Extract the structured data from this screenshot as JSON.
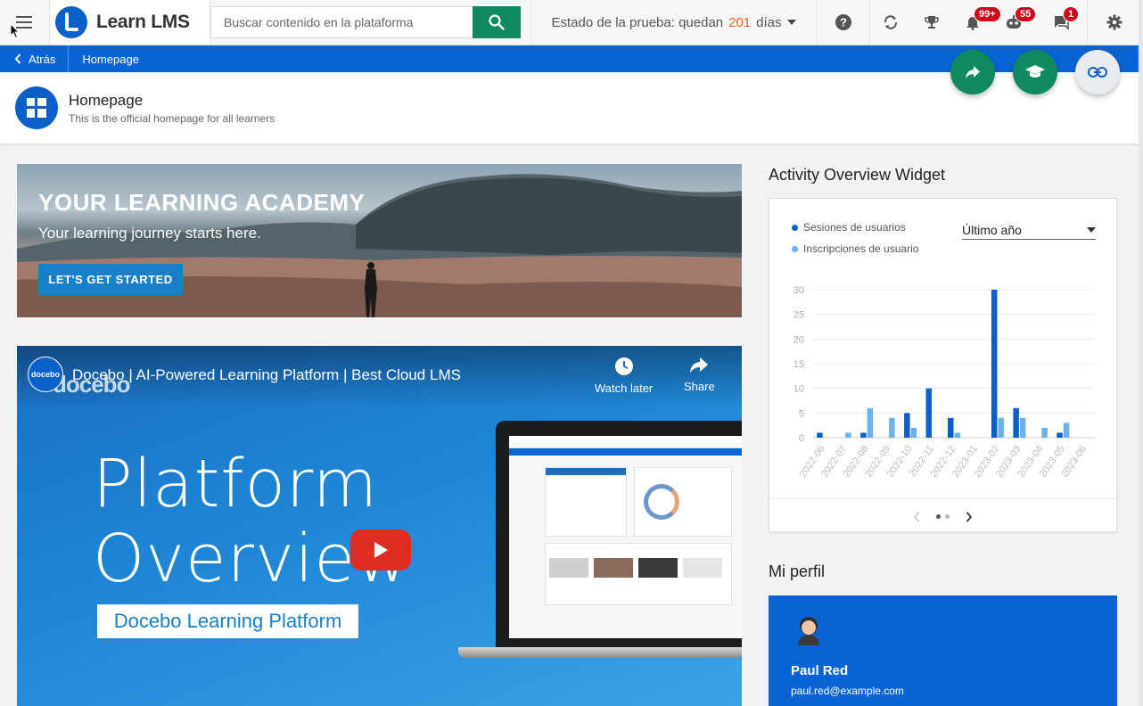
{
  "header": {
    "app_name": "Learn LMS",
    "search_placeholder": "Buscar contenido en la plataforma",
    "trial_prefix": "Estado de la prueba: quedan",
    "trial_days": "201",
    "trial_suffix": "días",
    "notifications_badge": "99+",
    "messages_badge": "55",
    "chat_badge": "1"
  },
  "breadcrumb": {
    "back_label": "Atrás",
    "current": "Homepage"
  },
  "page": {
    "title": "Homepage",
    "subtitle": "This is the official homepage for all learners"
  },
  "banner": {
    "title": "YOUR LEARNING ACADEMY",
    "subtitle": "Your learning journey starts here.",
    "button": "LET'S GET STARTED"
  },
  "video": {
    "channel_logo": "docebo",
    "brand_watermark": "docebo",
    "title": "Docebo | AI-Powered Learning Platform | Best Cloud LMS",
    "watch_later": "Watch later",
    "share": "Share",
    "big_line_1": "Platform",
    "big_line_2": "Overview",
    "box_text": "Docebo Learning Platform"
  },
  "activity": {
    "title": "Activity Overview Widget",
    "legend_sessions": "Sesiones de usuarios",
    "legend_enrollments": "Inscripciones de usuario",
    "period": "Último año",
    "colors": {
      "sessions": "#0a5fc9",
      "enrollments": "#6cb0ec"
    }
  },
  "chart_data": {
    "type": "bar",
    "categories": [
      "2022-06",
      "2022-07",
      "2022-08",
      "2022-09",
      "2022-10",
      "2022-11",
      "2022-12",
      "2023-01",
      "2023-02",
      "2023-03",
      "2023-04",
      "2023-05",
      "2023-06"
    ],
    "series": [
      {
        "name": "Sesiones de usuarios",
        "values": [
          1,
          0,
          1,
          0,
          5,
          10,
          4,
          0,
          30,
          6,
          0,
          1,
          0
        ]
      },
      {
        "name": "Inscripciones de usuario",
        "values": [
          0,
          1,
          6,
          4,
          2,
          0,
          1,
          0,
          4,
          4,
          2,
          3,
          0
        ]
      }
    ],
    "ylim": [
      0,
      30
    ],
    "yticks": [
      0,
      5,
      10,
      15,
      20,
      25,
      30
    ],
    "grid": true
  },
  "profile": {
    "section_title": "Mi perfil",
    "name": "Paul Red",
    "email": "paul.red@example.com"
  }
}
